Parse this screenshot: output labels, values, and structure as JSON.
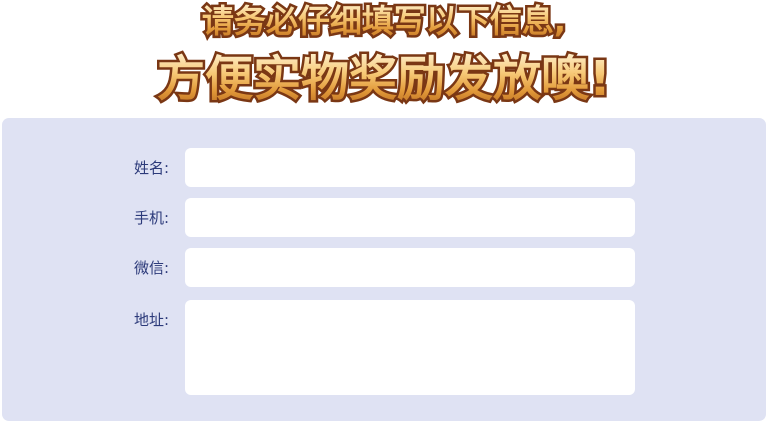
{
  "headline": {
    "line1": "请务必仔细填写以下信息,",
    "line2": "方便实物奖励发放噢!"
  },
  "form": {
    "name_label": "姓名:",
    "name_value": "",
    "phone_label": "手机:",
    "phone_value": "",
    "wechat_label": "微信:",
    "wechat_value": "",
    "address_label": "地址:",
    "address_value": ""
  },
  "colors": {
    "panel_background": "#dfe2f3",
    "label_text": "#2c3a7a",
    "headline_gold": "#e29a3a",
    "headline_outline": "#7a3714"
  }
}
